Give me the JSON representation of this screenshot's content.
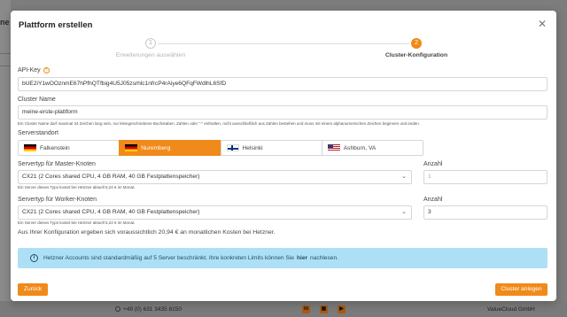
{
  "background": {
    "left_title": "ne",
    "footer_phone": "+49 (0) 631 3435 8150",
    "social": [
      "in",
      "▣",
      "▶"
    ],
    "footer_company": "ValueCloud GmbH"
  },
  "modal": {
    "title": "Plattform erstellen",
    "close_icon": "close-icon",
    "steps": [
      {
        "number": "1",
        "label": "Erweiterungen auswählen",
        "state": "done"
      },
      {
        "number": "2",
        "label": "Cluster-Konfiguration",
        "state": "active"
      }
    ],
    "api_key": {
      "label": "API-Key",
      "help": "?",
      "value": "bUE2iY1wOOznmE67hPfhQTfbig4U5J05zsrhlc1nfrcP4rAiye6QFqFWdlhL6SfD"
    },
    "cluster_name": {
      "label": "Cluster Name",
      "value": "meine-erste-plattform",
      "hint": "Ein Cluster Name darf maximal 34 Zeichen lang sein, nur kleingeschriebene Buchstaben, Zahlen oder \"-\" enthalten, nicht ausschließlich aus Zahlen bestehen und muss mit einem alphanumerischen Zeichen beginnen und enden."
    },
    "location": {
      "label": "Serverstandort",
      "options": [
        {
          "label": "Falkenstein",
          "flag": "de",
          "active": false
        },
        {
          "label": "Nuremberg",
          "flag": "de",
          "active": true
        },
        {
          "label": "Helsinki",
          "flag": "fi",
          "active": false
        },
        {
          "label": "Ashburn, VA",
          "flag": "us",
          "active": false
        }
      ]
    },
    "master": {
      "label": "Servertyp für Master-Knoten",
      "value": "CX21 (2 Cores shared CPU, 4 GB RAM, 40 GB Festplattenspeicher)",
      "hint": "Ein Server dieses Typs kostet bei Hetzner aktuell 5,24 € im Monat.",
      "count_label": "Anzahl",
      "count_placeholder": "1"
    },
    "worker": {
      "label": "Servertyp für Worker-Knoten",
      "value": "CX21 (2 Cores shared CPU, 4 GB RAM, 40 GB Festplattenspeicher)",
      "hint": "Ein Server dieses Typs kostet bei Hetzner aktuell 5,24 € im Monat.",
      "count_label": "Anzahl",
      "count_value": "3"
    },
    "cost_text": "Aus Ihrer Konfiguration ergeben sich voraussichtlich 20,94 € an monatlichen Kosten bei Hetzner.",
    "info": {
      "before": "Hetzner Accounts sind standardmäßig auf 5 Server beschränkt. Ihre konkreten Limits können Sie",
      "link": "hier",
      "after": "nachlesen."
    },
    "back_label": "Zurück",
    "create_label": "Cluster anlegen"
  },
  "colors": {
    "accent": "#f08a1a",
    "info_bg": "#aee0f5"
  }
}
